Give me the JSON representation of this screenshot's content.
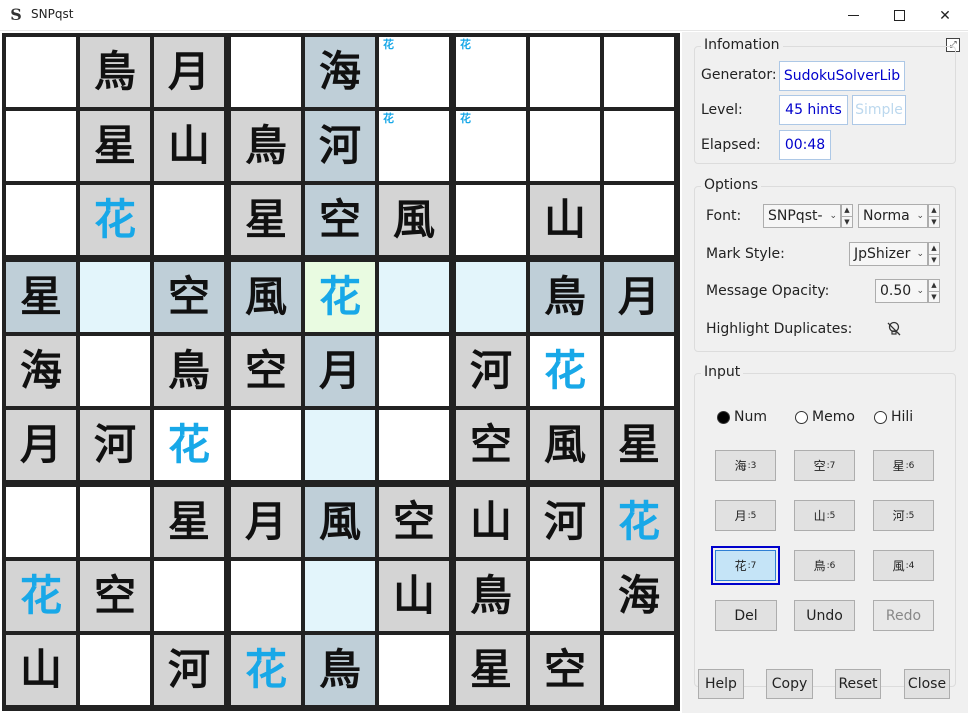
{
  "window": {
    "title": "SNPqst",
    "logo": "S"
  },
  "board": {
    "rows": [
      [
        {
          "v": "",
          "s": "w"
        },
        {
          "v": "鳥",
          "s": "g"
        },
        {
          "v": "月",
          "s": "g"
        },
        {
          "v": "",
          "s": "w"
        },
        {
          "v": "海",
          "s": "b"
        },
        {
          "v": "",
          "s": "w",
          "memo": "花"
        },
        {
          "v": "",
          "s": "w",
          "memo": "花"
        },
        {
          "v": "",
          "s": "w"
        },
        {
          "v": "",
          "s": "w"
        }
      ],
      [
        {
          "v": "",
          "s": "w"
        },
        {
          "v": "星",
          "s": "g"
        },
        {
          "v": "山",
          "s": "g"
        },
        {
          "v": "鳥",
          "s": "g"
        },
        {
          "v": "河",
          "s": "b"
        },
        {
          "v": "",
          "s": "w",
          "memo": "花"
        },
        {
          "v": "",
          "s": "w",
          "memo": "花"
        },
        {
          "v": "",
          "s": "w"
        },
        {
          "v": "",
          "s": "w"
        }
      ],
      [
        {
          "v": "",
          "s": "w"
        },
        {
          "v": "花",
          "s": "g",
          "u": 1
        },
        {
          "v": "",
          "s": "w"
        },
        {
          "v": "星",
          "s": "g"
        },
        {
          "v": "空",
          "s": "b"
        },
        {
          "v": "風",
          "s": "g"
        },
        {
          "v": "",
          "s": "w"
        },
        {
          "v": "山",
          "s": "g"
        },
        {
          "v": "",
          "s": "w"
        }
      ],
      [
        {
          "v": "星",
          "s": "b"
        },
        {
          "v": "",
          "s": "lb"
        },
        {
          "v": "空",
          "s": "b"
        },
        {
          "v": "風",
          "s": "b"
        },
        {
          "v": "花",
          "s": "sel",
          "u": 1
        },
        {
          "v": "",
          "s": "lb"
        },
        {
          "v": "",
          "s": "lb"
        },
        {
          "v": "鳥",
          "s": "b"
        },
        {
          "v": "月",
          "s": "b"
        }
      ],
      [
        {
          "v": "海",
          "s": "g"
        },
        {
          "v": "",
          "s": "w"
        },
        {
          "v": "鳥",
          "s": "g"
        },
        {
          "v": "空",
          "s": "g"
        },
        {
          "v": "月",
          "s": "b"
        },
        {
          "v": "",
          "s": "w"
        },
        {
          "v": "河",
          "s": "g"
        },
        {
          "v": "花",
          "s": "w",
          "u": 1
        },
        {
          "v": "",
          "s": "w"
        }
      ],
      [
        {
          "v": "月",
          "s": "g"
        },
        {
          "v": "河",
          "s": "g"
        },
        {
          "v": "花",
          "s": "w",
          "u": 1
        },
        {
          "v": "",
          "s": "w"
        },
        {
          "v": "",
          "s": "lb"
        },
        {
          "v": "",
          "s": "w"
        },
        {
          "v": "空",
          "s": "g"
        },
        {
          "v": "風",
          "s": "g"
        },
        {
          "v": "星",
          "s": "g"
        }
      ],
      [
        {
          "v": "",
          "s": "w"
        },
        {
          "v": "",
          "s": "w"
        },
        {
          "v": "星",
          "s": "g"
        },
        {
          "v": "月",
          "s": "g"
        },
        {
          "v": "風",
          "s": "b"
        },
        {
          "v": "空",
          "s": "g"
        },
        {
          "v": "山",
          "s": "g"
        },
        {
          "v": "河",
          "s": "g"
        },
        {
          "v": "花",
          "s": "g",
          "u": 1
        }
      ],
      [
        {
          "v": "花",
          "s": "g",
          "u": 1
        },
        {
          "v": "空",
          "s": "g"
        },
        {
          "v": "",
          "s": "w"
        },
        {
          "v": "",
          "s": "w"
        },
        {
          "v": "",
          "s": "lb"
        },
        {
          "v": "山",
          "s": "g"
        },
        {
          "v": "鳥",
          "s": "g"
        },
        {
          "v": "",
          "s": "w"
        },
        {
          "v": "海",
          "s": "g"
        }
      ],
      [
        {
          "v": "山",
          "s": "g"
        },
        {
          "v": "",
          "s": "w"
        },
        {
          "v": "河",
          "s": "g"
        },
        {
          "v": "花",
          "s": "g",
          "u": 1
        },
        {
          "v": "鳥",
          "s": "b"
        },
        {
          "v": "",
          "s": "w"
        },
        {
          "v": "星",
          "s": "g"
        },
        {
          "v": "空",
          "s": "g"
        },
        {
          "v": "",
          "s": "w"
        }
      ]
    ]
  },
  "info": {
    "title": "Infomation",
    "generator_label": "Generator:",
    "generator": "SudokuSolverLib",
    "level_label": "Level:",
    "level": "45 hints",
    "level_name": "Simple",
    "elapsed_label": "Elapsed:",
    "elapsed": "00:48"
  },
  "options": {
    "title": "Options",
    "font_label": "Font:",
    "font_value": "SNPqst-",
    "weight_value": "Norma",
    "mark_label": "Mark Style:",
    "mark_value": "JpShizer",
    "opacity_label": "Message Opacity:",
    "opacity_value": "0.50",
    "highlight_label": "Highlight Duplicates:"
  },
  "input": {
    "title": "Input",
    "modes": [
      "Num",
      "Memo",
      "Hili"
    ],
    "keys": [
      {
        "ch": "海",
        "n": ":3"
      },
      {
        "ch": "空",
        "n": ":7"
      },
      {
        "ch": "星",
        "n": ":6"
      },
      {
        "ch": "月",
        "n": ":5"
      },
      {
        "ch": "山",
        "n": ":5"
      },
      {
        "ch": "河",
        "n": ":5"
      },
      {
        "ch": "花",
        "n": ":7"
      },
      {
        "ch": "鳥",
        "n": ":6"
      },
      {
        "ch": "風",
        "n": ":4"
      }
    ],
    "del": "Del",
    "undo": "Undo",
    "redo": "Redo"
  },
  "footer": {
    "help": "Help",
    "copy": "Copy",
    "reset": "Reset",
    "close": "Close"
  }
}
